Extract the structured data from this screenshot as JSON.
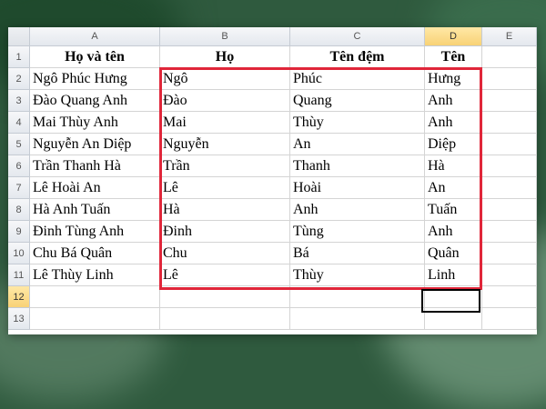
{
  "columns": [
    "A",
    "B",
    "C",
    "D",
    "E"
  ],
  "rows": [
    {
      "n": "1",
      "cells": [
        "Họ và tên",
        "Họ",
        "Tên đệm",
        "Tên",
        ""
      ]
    },
    {
      "n": "2",
      "cells": [
        "Ngô Phúc Hưng",
        "Ngô",
        "Phúc",
        "Hưng",
        ""
      ]
    },
    {
      "n": "3",
      "cells": [
        "Đào Quang Anh",
        "Đào",
        "Quang",
        "Anh",
        ""
      ]
    },
    {
      "n": "4",
      "cells": [
        "Mai Thùy Anh",
        "Mai",
        "Thùy",
        "Anh",
        ""
      ]
    },
    {
      "n": "5",
      "cells": [
        "Nguyễn An Diệp",
        "Nguyễn",
        "An",
        "Diệp",
        ""
      ]
    },
    {
      "n": "6",
      "cells": [
        "Trần Thanh Hà",
        "Trần",
        "Thanh",
        "Hà",
        ""
      ]
    },
    {
      "n": "7",
      "cells": [
        "Lê Hoài An",
        "Lê",
        "Hoài",
        "An",
        ""
      ]
    },
    {
      "n": "8",
      "cells": [
        "Hà Anh Tuấn",
        "Hà",
        "Anh",
        "Tuấn",
        ""
      ]
    },
    {
      "n": "9",
      "cells": [
        "Đinh Tùng Anh",
        "Đinh",
        "Tùng",
        "Anh",
        ""
      ]
    },
    {
      "n": "10",
      "cells": [
        "Chu Bá Quân",
        "Chu",
        "Bá",
        "Quân",
        ""
      ]
    },
    {
      "n": "11",
      "cells": [
        "Lê Thùy Linh",
        "Lê",
        "Thùy",
        "Linh",
        ""
      ]
    },
    {
      "n": "12",
      "cells": [
        "",
        "",
        "",
        "",
        ""
      ]
    },
    {
      "n": "13",
      "cells": [
        "",
        "",
        "",
        "",
        ""
      ]
    }
  ],
  "selected": {
    "column": "D",
    "row": "12"
  },
  "highlight_color": "#e0263a"
}
